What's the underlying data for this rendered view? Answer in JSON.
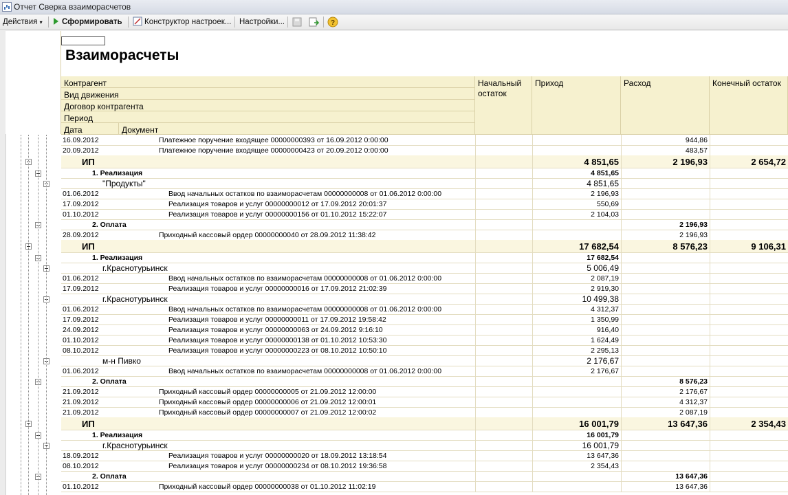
{
  "window": {
    "title": "Отчет  Сверка взаиморасчетов"
  },
  "toolbar": {
    "actions": "Действия",
    "generate": "Сформировать",
    "constructor": "Конструктор настроек...",
    "settings": "Настройки..."
  },
  "report": {
    "title": "Взаиморасчеты",
    "header": {
      "counterparty": "Контрагент",
      "movement": "Вид движения",
      "contract": "Договор контрагента",
      "period": "Период",
      "date": "Дата",
      "document": "Документ",
      "start_balance": "Начальный остаток",
      "income": "Приход",
      "expense": "Расход",
      "end_balance": "Конечный остаток"
    },
    "rows": [
      {
        "type": "det",
        "date": "16.09.2012",
        "doc": "Платежное поручение входящее 00000000393 от 16.09.2012 0:00:00",
        "start": "",
        "in": "",
        "out": "944,86",
        "end": ""
      },
      {
        "type": "det",
        "date": "20.09.2012",
        "doc": "Платежное поручение входящее 00000000423 от 20.09.2012 0:00:00",
        "start": "",
        "in": "",
        "out": "483,57",
        "end": ""
      },
      {
        "type": "grp",
        "doc": "ИП",
        "start": "",
        "in": "4 851,65",
        "out": "2 196,93",
        "end": "2 654,72"
      },
      {
        "type": "sub",
        "doc": "1. Реализация",
        "start": "",
        "in": "4 851,65",
        "out": "",
        "end": ""
      },
      {
        "type": "lvl3",
        "doc": "\"Продукты\"",
        "start": "",
        "in": "4 851,65",
        "out": "",
        "end": ""
      },
      {
        "type": "det",
        "date": "01.06.2012",
        "doc": "Ввод начальных остатков по взаиморасчетам 00000000008 от 01.06.2012 0:00:00",
        "start": "",
        "in": "2 196,93",
        "out": "",
        "end": ""
      },
      {
        "type": "det",
        "date": "17.09.2012",
        "doc": "Реализация товаров и услуг 00000000012 от 17.09.2012 20:01:37",
        "start": "",
        "in": "550,69",
        "out": "",
        "end": ""
      },
      {
        "type": "det",
        "date": "01.10.2012",
        "doc": "Реализация товаров и услуг 00000000156 от 01.10.2012 15:22:07",
        "start": "",
        "in": "2 104,03",
        "out": "",
        "end": ""
      },
      {
        "type": "sub",
        "doc": "2. Оплата",
        "start": "",
        "in": "",
        "out": "2 196,93",
        "end": ""
      },
      {
        "type": "det",
        "date": "28.09.2012",
        "doc": "Приходный кассовый ордер 00000000040 от 28.09.2012 11:38:42",
        "start": "",
        "in": "",
        "out": "2 196,93",
        "end": ""
      },
      {
        "type": "grp",
        "doc": "ИП",
        "start": "",
        "in": "17 682,54",
        "out": "8 576,23",
        "end": "9 106,31"
      },
      {
        "type": "sub",
        "doc": "1. Реализация",
        "start": "",
        "in": "17 682,54",
        "out": "",
        "end": ""
      },
      {
        "type": "lvl3",
        "doc": "г.Краснотурьинск",
        "start": "",
        "in": "5 006,49",
        "out": "",
        "end": ""
      },
      {
        "type": "det",
        "date": "01.06.2012",
        "doc": "Ввод начальных остатков по взаиморасчетам 00000000008 от 01.06.2012 0:00:00",
        "start": "",
        "in": "2 087,19",
        "out": "",
        "end": ""
      },
      {
        "type": "det",
        "date": "17.09.2012",
        "doc": "Реализация товаров и услуг 00000000016 от 17.09.2012 21:02:39",
        "start": "",
        "in": "2 919,30",
        "out": "",
        "end": ""
      },
      {
        "type": "lvl3",
        "doc": "г.Краснотурьинск",
        "start": "",
        "in": "10 499,38",
        "out": "",
        "end": ""
      },
      {
        "type": "det",
        "date": "01.06.2012",
        "doc": "Ввод начальных остатков по взаиморасчетам 00000000008 от 01.06.2012 0:00:00",
        "start": "",
        "in": "4 312,37",
        "out": "",
        "end": ""
      },
      {
        "type": "det",
        "date": "17.09.2012",
        "doc": "Реализация товаров и услуг 00000000011 от 17.09.2012 19:58:42",
        "start": "",
        "in": "1 350,99",
        "out": "",
        "end": ""
      },
      {
        "type": "det",
        "date": "24.09.2012",
        "doc": "Реализация товаров и услуг 00000000063 от 24.09.2012 9:16:10",
        "start": "",
        "in": "916,40",
        "out": "",
        "end": ""
      },
      {
        "type": "det",
        "date": "01.10.2012",
        "doc": "Реализация товаров и услуг 00000000138 от 01.10.2012 10:53:30",
        "start": "",
        "in": "1 624,49",
        "out": "",
        "end": ""
      },
      {
        "type": "det",
        "date": "08.10.2012",
        "doc": "Реализация товаров и услуг 00000000223 от 08.10.2012 10:50:10",
        "start": "",
        "in": "2 295,13",
        "out": "",
        "end": ""
      },
      {
        "type": "lvl3",
        "doc": "м-н Пивко",
        "start": "",
        "in": "2 176,67",
        "out": "",
        "end": ""
      },
      {
        "type": "det",
        "date": "01.06.2012",
        "doc": "Ввод начальных остатков по взаиморасчетам 00000000008 от 01.06.2012 0:00:00",
        "start": "",
        "in": "2 176,67",
        "out": "",
        "end": ""
      },
      {
        "type": "sub",
        "doc": "2. Оплата",
        "start": "",
        "in": "",
        "out": "8 576,23",
        "end": ""
      },
      {
        "type": "det",
        "date": "21.09.2012",
        "doc": "Приходный кассовый ордер 00000000005 от 21.09.2012 12:00:00",
        "start": "",
        "in": "",
        "out": "2 176,67",
        "end": ""
      },
      {
        "type": "det",
        "date": "21.09.2012",
        "doc": "Приходный кассовый ордер 00000000006 от 21.09.2012 12:00:01",
        "start": "",
        "in": "",
        "out": "4 312,37",
        "end": ""
      },
      {
        "type": "det",
        "date": "21.09.2012",
        "doc": "Приходный кассовый ордер 00000000007 от 21.09.2012 12:00:02",
        "start": "",
        "in": "",
        "out": "2 087,19",
        "end": ""
      },
      {
        "type": "grp",
        "doc": "ИП",
        "start": "",
        "in": "16 001,79",
        "out": "13 647,36",
        "end": "2 354,43"
      },
      {
        "type": "sub",
        "doc": "1. Реализация",
        "start": "",
        "in": "16 001,79",
        "out": "",
        "end": ""
      },
      {
        "type": "lvl3",
        "doc": "г.Краснотурьинск",
        "start": "",
        "in": "16 001,79",
        "out": "",
        "end": ""
      },
      {
        "type": "det",
        "date": "18.09.2012",
        "doc": "Реализация товаров и услуг 00000000020 от 18.09.2012 13:18:54",
        "start": "",
        "in": "13 647,36",
        "out": "",
        "end": ""
      },
      {
        "type": "det",
        "date": "08.10.2012",
        "doc": "Реализация товаров и услуг 00000000234 от 08.10.2012 19:36:58",
        "start": "",
        "in": "2 354,43",
        "out": "",
        "end": ""
      },
      {
        "type": "sub",
        "doc": "2. Оплата",
        "start": "",
        "in": "",
        "out": "13 647,36",
        "end": ""
      },
      {
        "type": "det",
        "date": "01.10.2012",
        "doc": "Приходный кассовый ордер 00000000038 от 01.10.2012 11:02:19",
        "start": "",
        "in": "",
        "out": "13 647,36",
        "end": ""
      }
    ]
  }
}
